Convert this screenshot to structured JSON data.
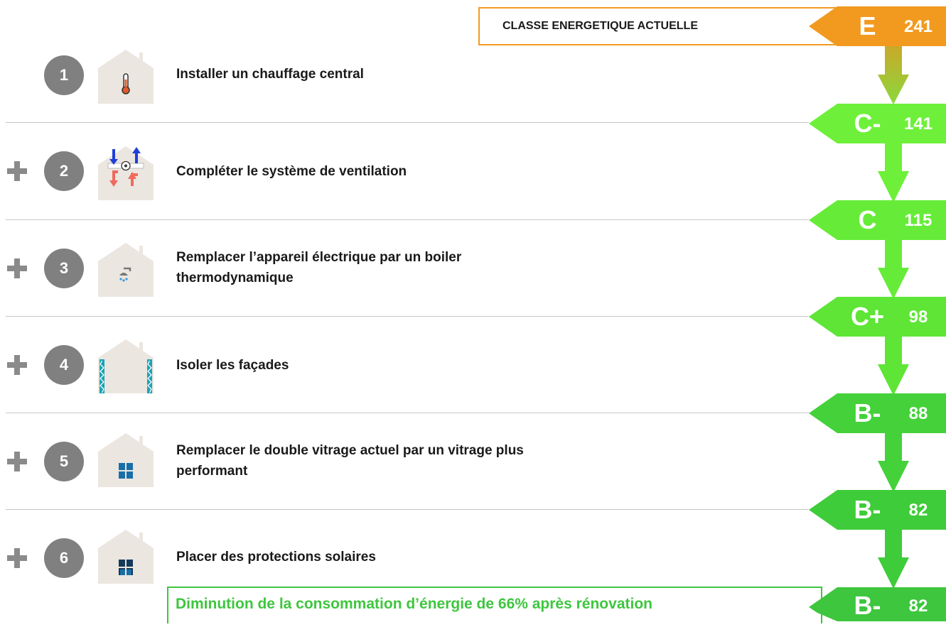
{
  "header": {
    "label": "CLASSE ENERGETIQUE ACTUELLE",
    "class": "E",
    "value": "241",
    "color": "#f29a1f"
  },
  "steps": [
    {
      "number": "1",
      "label": "Installer un chauffage central",
      "plus": false,
      "icon": "thermometer-icon"
    },
    {
      "number": "2",
      "label": "Compléter le système de ventilation",
      "plus": true,
      "icon": "ventilation-icon"
    },
    {
      "number": "3",
      "label": "Remplacer l’appareil électrique par un boiler thermodynamique",
      "plus": true,
      "icon": "shower-icon"
    },
    {
      "number": "4",
      "label": "Isoler les façades",
      "plus": true,
      "icon": "wall-insulation-icon"
    },
    {
      "number": "5",
      "label": "Remplacer le double vitrage actuel par un vitrage plus performant",
      "plus": true,
      "icon": "window-icon"
    },
    {
      "number": "6",
      "label": "Placer des protections solaires",
      "plus": true,
      "icon": "sun-shade-icon"
    }
  ],
  "ratings": [
    {
      "class": "C-",
      "value": "141",
      "color": "#6ef03a"
    },
    {
      "class": "C",
      "value": "115",
      "color": "#66ec38"
    },
    {
      "class": "C+",
      "value": "98",
      "color": "#5ee536"
    },
    {
      "class": "B-",
      "value": "88",
      "color": "#44d13a"
    },
    {
      "class": "B-",
      "value": "82",
      "color": "#3fcc3a"
    }
  ],
  "summary": {
    "text": "Diminution de la consommation d’énergie de 66% après rénovation",
    "class": "B-",
    "value": "82",
    "color": "#3ec63e"
  }
}
